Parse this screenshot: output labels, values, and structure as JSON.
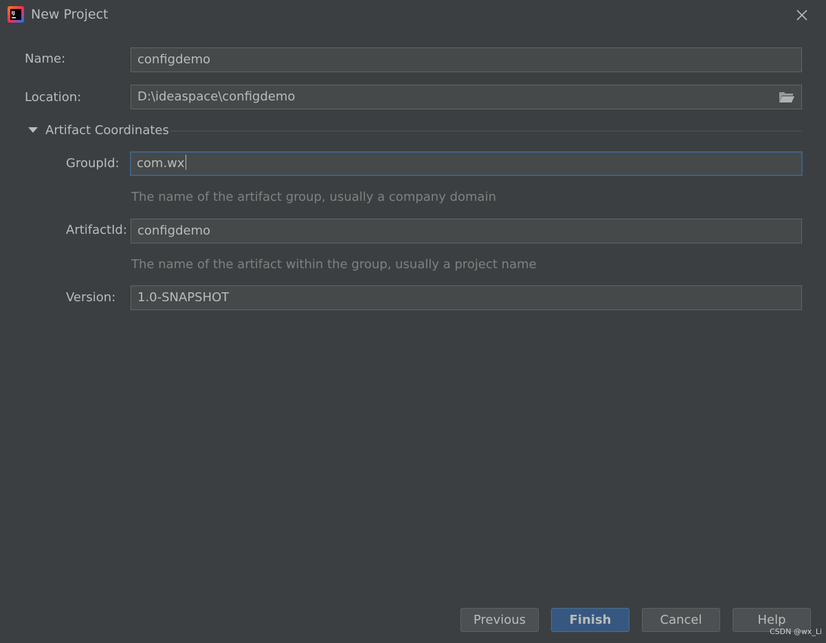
{
  "window": {
    "title": "New Project",
    "app_icon": "intellij-idea-icon",
    "close_icon": "close-icon"
  },
  "form": {
    "name": {
      "label": "Name:",
      "value": "configdemo"
    },
    "location": {
      "label": "Location:",
      "value": "D:\\ideaspace\\configdemo",
      "browse_icon": "folder-open-icon"
    },
    "artifact_section": {
      "title": "Artifact Coordinates",
      "expanded": true,
      "toggle_icon": "triangle-down-icon"
    },
    "group_id": {
      "label": "GroupId:",
      "value": "com.wx",
      "hint": "The name of the artifact group, usually a company domain"
    },
    "artifact_id": {
      "label": "ArtifactId:",
      "value": "configdemo",
      "hint": "The name of the artifact within the group, usually a project name"
    },
    "version": {
      "label": "Version:",
      "value": "1.0-SNAPSHOT"
    }
  },
  "buttons": {
    "previous": "Previous",
    "finish": "Finish",
    "cancel": "Cancel",
    "help": "Help"
  },
  "watermark": "CSDN @wx_Li",
  "colors": {
    "background": "#3c3f41",
    "field_background": "#45494a",
    "focus_border": "#3d6185",
    "primary_button": "#365880"
  }
}
